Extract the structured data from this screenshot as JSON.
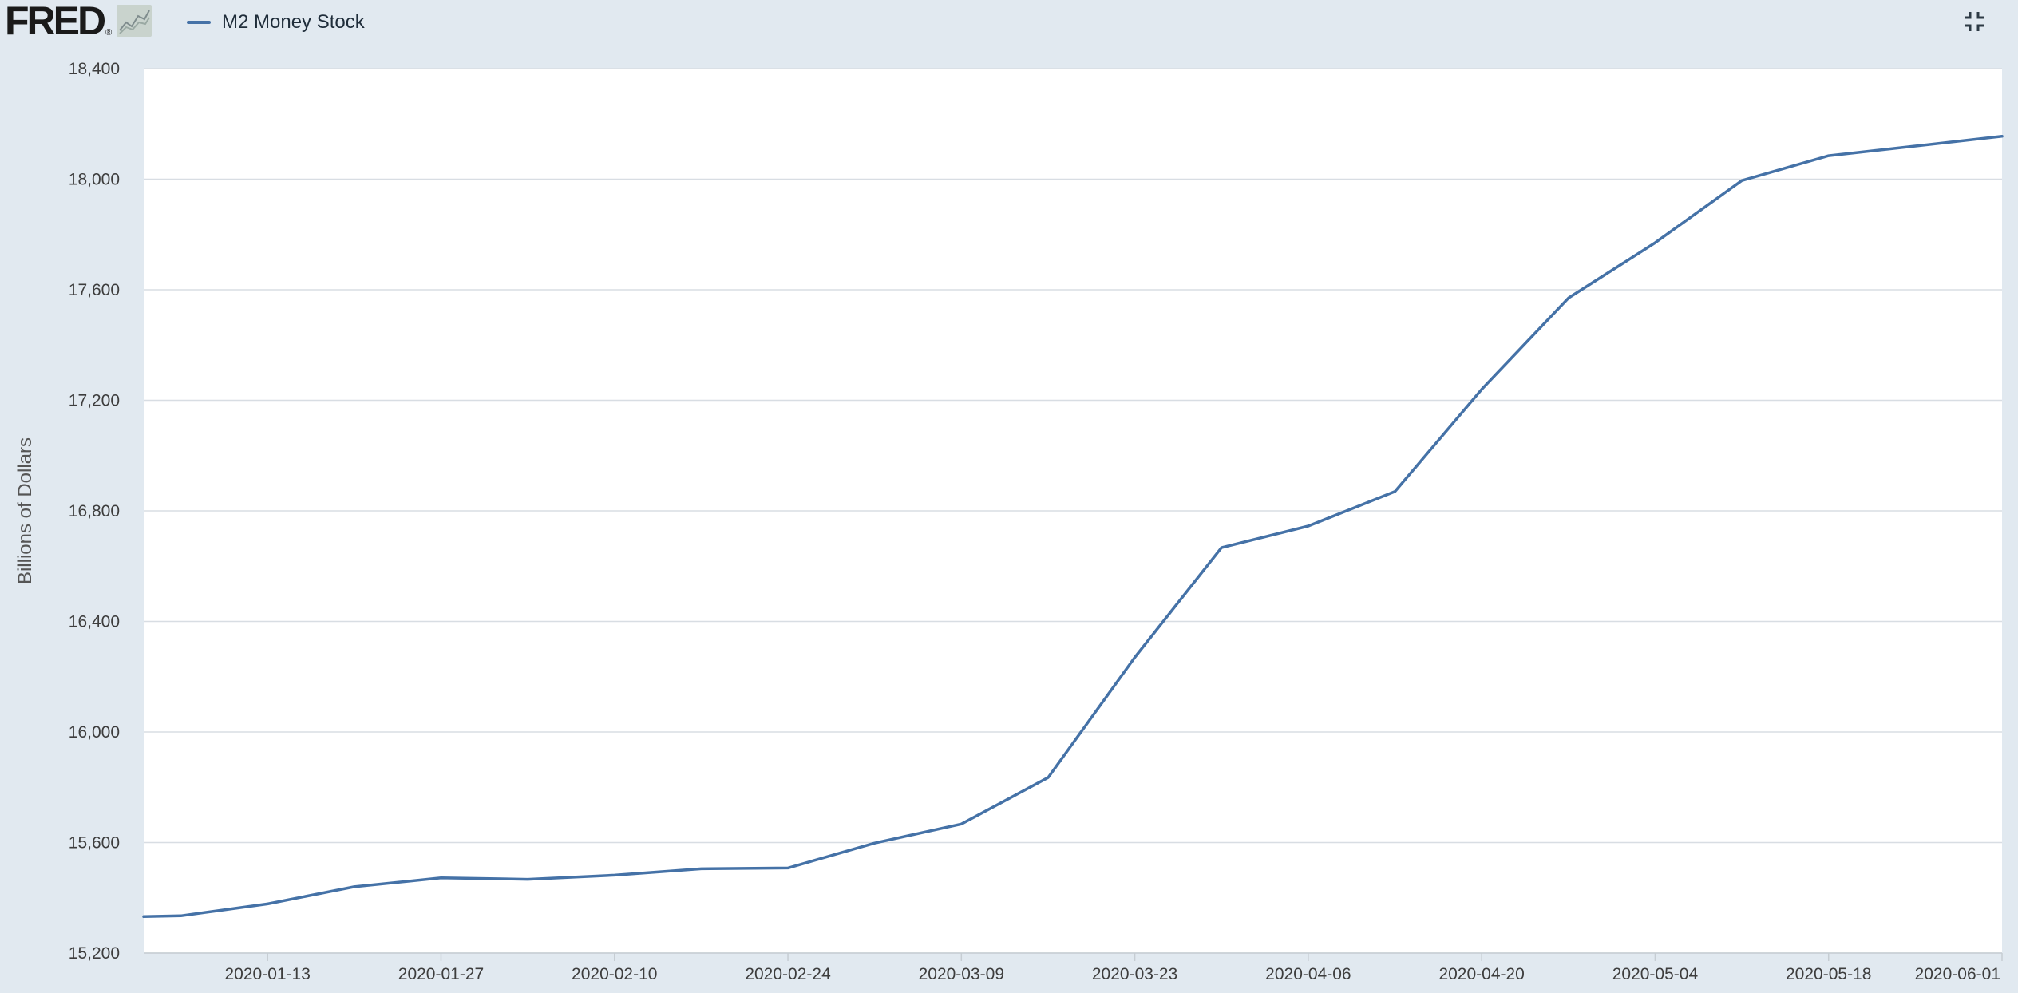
{
  "header": {
    "logo_text": "FRED",
    "logo_mark": "®",
    "graph_icon": "line-chart-icon",
    "collapse_icon": "collapse-fullscreen-icon"
  },
  "colors": {
    "background": "#e1e9f0",
    "plot_background": "#ffffff",
    "series": "#4572a7",
    "grid": "#d8dde3"
  },
  "chart_data": {
    "type": "line",
    "title": "",
    "xlabel": "",
    "ylabel": "Billions of Dollars",
    "grid": true,
    "legend_position": "top-left",
    "ylim": [
      15200,
      18400
    ],
    "xlim": [
      "2020-01-03",
      "2020-06-01"
    ],
    "y_ticks": [
      15200,
      15600,
      16000,
      16400,
      16800,
      17200,
      17600,
      18000,
      18400
    ],
    "y_tick_labels": [
      "15,200",
      "15,600",
      "16,000",
      "16,400",
      "16,800",
      "17,200",
      "17,600",
      "18,000",
      "18,400"
    ],
    "x_ticks": [
      "2020-01-13",
      "2020-01-27",
      "2020-02-10",
      "2020-02-24",
      "2020-03-09",
      "2020-03-23",
      "2020-04-06",
      "2020-04-20",
      "2020-05-04",
      "2020-05-18",
      "2020-06-01"
    ],
    "series": [
      {
        "name": "M2 Money Stock",
        "color": "#4572a7",
        "x": [
          "2020-01-03",
          "2020-01-06",
          "2020-01-13",
          "2020-01-20",
          "2020-01-27",
          "2020-02-03",
          "2020-02-10",
          "2020-02-17",
          "2020-02-24",
          "2020-03-02",
          "2020-03-09",
          "2020-03-16",
          "2020-03-23",
          "2020-03-30",
          "2020-04-06",
          "2020-04-13",
          "2020-04-20",
          "2020-04-27",
          "2020-05-04",
          "2020-05-11",
          "2020-05-18",
          "2020-05-25",
          "2020-06-01"
        ],
        "y": [
          15332,
          15335,
          15378,
          15440,
          15472,
          15467,
          15482,
          15505,
          15508,
          15598,
          15667,
          15835,
          16270,
          16667,
          16745,
          16870,
          17240,
          17570,
          17770,
          17995,
          18085,
          18120,
          18155
        ]
      }
    ]
  }
}
